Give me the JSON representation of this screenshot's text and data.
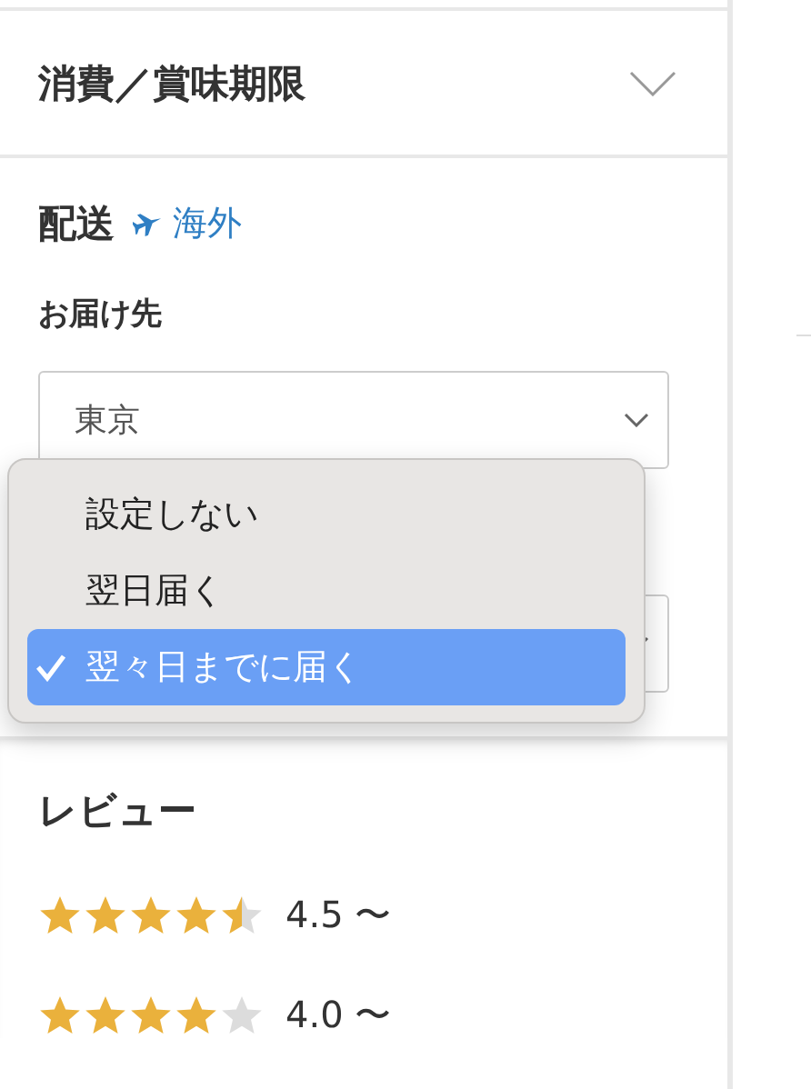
{
  "sections": [
    {
      "title": "消費／賞味期限",
      "expanded": false
    },
    {
      "title": "配送",
      "link": "海外"
    },
    {
      "title": "レビュー"
    }
  ],
  "shipping": {
    "destination_label": "お届け先",
    "destination": {
      "value": "東京"
    },
    "delivery_dropdown": {
      "options": [
        {
          "label": "設定しない",
          "selected": false
        },
        {
          "label": "翌日届く",
          "selected": false
        },
        {
          "label": "翌々日までに届く",
          "selected": true
        }
      ]
    }
  },
  "reviews": [
    {
      "stars": 4.5,
      "label": "4.5 〜"
    },
    {
      "stars": 4,
      "label": "4.0 〜"
    }
  ]
}
